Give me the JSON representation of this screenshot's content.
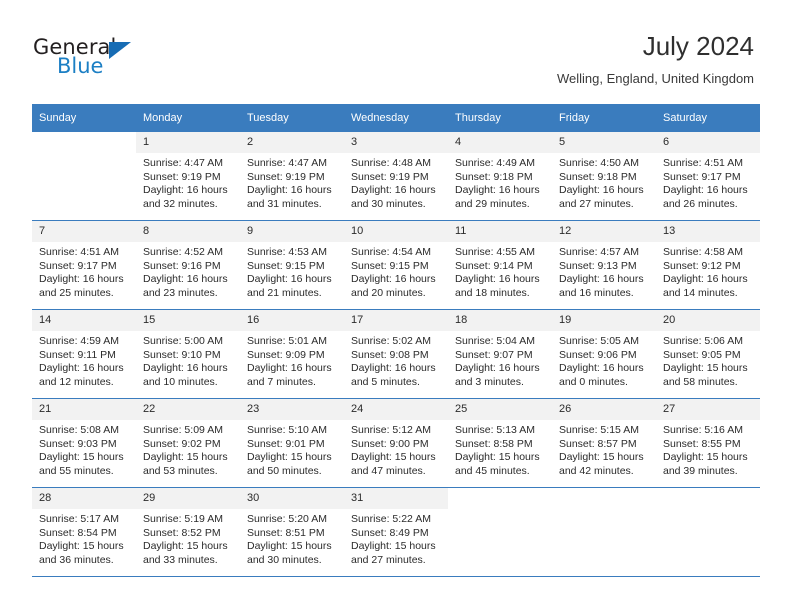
{
  "brand": {
    "word1": "General",
    "word2": "Blue",
    "logo_icon": "triangle-logo-icon",
    "accent_color": "#176cb4"
  },
  "header": {
    "title": "July 2024",
    "subtitle": "Welling, England, United Kingdom"
  },
  "theme": {
    "header_row_bg": "#3a7cbe",
    "daynum_bg": "#f2f2f2",
    "text_color": "#2b2b2b"
  },
  "weekday_headers": [
    "Sunday",
    "Monday",
    "Tuesday",
    "Wednesday",
    "Thursday",
    "Friday",
    "Saturday"
  ],
  "weeks": [
    [
      {
        "day": "",
        "sunrise": "",
        "sunset": "",
        "daylight1": "",
        "daylight2": ""
      },
      {
        "day": "1",
        "sunrise": "Sunrise: 4:47 AM",
        "sunset": "Sunset: 9:19 PM",
        "daylight1": "Daylight: 16 hours",
        "daylight2": "and 32 minutes."
      },
      {
        "day": "2",
        "sunrise": "Sunrise: 4:47 AM",
        "sunset": "Sunset: 9:19 PM",
        "daylight1": "Daylight: 16 hours",
        "daylight2": "and 31 minutes."
      },
      {
        "day": "3",
        "sunrise": "Sunrise: 4:48 AM",
        "sunset": "Sunset: 9:19 PM",
        "daylight1": "Daylight: 16 hours",
        "daylight2": "and 30 minutes."
      },
      {
        "day": "4",
        "sunrise": "Sunrise: 4:49 AM",
        "sunset": "Sunset: 9:18 PM",
        "daylight1": "Daylight: 16 hours",
        "daylight2": "and 29 minutes."
      },
      {
        "day": "5",
        "sunrise": "Sunrise: 4:50 AM",
        "sunset": "Sunset: 9:18 PM",
        "daylight1": "Daylight: 16 hours",
        "daylight2": "and 27 minutes."
      },
      {
        "day": "6",
        "sunrise": "Sunrise: 4:51 AM",
        "sunset": "Sunset: 9:17 PM",
        "daylight1": "Daylight: 16 hours",
        "daylight2": "and 26 minutes."
      }
    ],
    [
      {
        "day": "7",
        "sunrise": "Sunrise: 4:51 AM",
        "sunset": "Sunset: 9:17 PM",
        "daylight1": "Daylight: 16 hours",
        "daylight2": "and 25 minutes."
      },
      {
        "day": "8",
        "sunrise": "Sunrise: 4:52 AM",
        "sunset": "Sunset: 9:16 PM",
        "daylight1": "Daylight: 16 hours",
        "daylight2": "and 23 minutes."
      },
      {
        "day": "9",
        "sunrise": "Sunrise: 4:53 AM",
        "sunset": "Sunset: 9:15 PM",
        "daylight1": "Daylight: 16 hours",
        "daylight2": "and 21 minutes."
      },
      {
        "day": "10",
        "sunrise": "Sunrise: 4:54 AM",
        "sunset": "Sunset: 9:15 PM",
        "daylight1": "Daylight: 16 hours",
        "daylight2": "and 20 minutes."
      },
      {
        "day": "11",
        "sunrise": "Sunrise: 4:55 AM",
        "sunset": "Sunset: 9:14 PM",
        "daylight1": "Daylight: 16 hours",
        "daylight2": "and 18 minutes."
      },
      {
        "day": "12",
        "sunrise": "Sunrise: 4:57 AM",
        "sunset": "Sunset: 9:13 PM",
        "daylight1": "Daylight: 16 hours",
        "daylight2": "and 16 minutes."
      },
      {
        "day": "13",
        "sunrise": "Sunrise: 4:58 AM",
        "sunset": "Sunset: 9:12 PM",
        "daylight1": "Daylight: 16 hours",
        "daylight2": "and 14 minutes."
      }
    ],
    [
      {
        "day": "14",
        "sunrise": "Sunrise: 4:59 AM",
        "sunset": "Sunset: 9:11 PM",
        "daylight1": "Daylight: 16 hours",
        "daylight2": "and 12 minutes."
      },
      {
        "day": "15",
        "sunrise": "Sunrise: 5:00 AM",
        "sunset": "Sunset: 9:10 PM",
        "daylight1": "Daylight: 16 hours",
        "daylight2": "and 10 minutes."
      },
      {
        "day": "16",
        "sunrise": "Sunrise: 5:01 AM",
        "sunset": "Sunset: 9:09 PM",
        "daylight1": "Daylight: 16 hours",
        "daylight2": "and 7 minutes."
      },
      {
        "day": "17",
        "sunrise": "Sunrise: 5:02 AM",
        "sunset": "Sunset: 9:08 PM",
        "daylight1": "Daylight: 16 hours",
        "daylight2": "and 5 minutes."
      },
      {
        "day": "18",
        "sunrise": "Sunrise: 5:04 AM",
        "sunset": "Sunset: 9:07 PM",
        "daylight1": "Daylight: 16 hours",
        "daylight2": "and 3 minutes."
      },
      {
        "day": "19",
        "sunrise": "Sunrise: 5:05 AM",
        "sunset": "Sunset: 9:06 PM",
        "daylight1": "Daylight: 16 hours",
        "daylight2": "and 0 minutes."
      },
      {
        "day": "20",
        "sunrise": "Sunrise: 5:06 AM",
        "sunset": "Sunset: 9:05 PM",
        "daylight1": "Daylight: 15 hours",
        "daylight2": "and 58 minutes."
      }
    ],
    [
      {
        "day": "21",
        "sunrise": "Sunrise: 5:08 AM",
        "sunset": "Sunset: 9:03 PM",
        "daylight1": "Daylight: 15 hours",
        "daylight2": "and 55 minutes."
      },
      {
        "day": "22",
        "sunrise": "Sunrise: 5:09 AM",
        "sunset": "Sunset: 9:02 PM",
        "daylight1": "Daylight: 15 hours",
        "daylight2": "and 53 minutes."
      },
      {
        "day": "23",
        "sunrise": "Sunrise: 5:10 AM",
        "sunset": "Sunset: 9:01 PM",
        "daylight1": "Daylight: 15 hours",
        "daylight2": "and 50 minutes."
      },
      {
        "day": "24",
        "sunrise": "Sunrise: 5:12 AM",
        "sunset": "Sunset: 9:00 PM",
        "daylight1": "Daylight: 15 hours",
        "daylight2": "and 47 minutes."
      },
      {
        "day": "25",
        "sunrise": "Sunrise: 5:13 AM",
        "sunset": "Sunset: 8:58 PM",
        "daylight1": "Daylight: 15 hours",
        "daylight2": "and 45 minutes."
      },
      {
        "day": "26",
        "sunrise": "Sunrise: 5:15 AM",
        "sunset": "Sunset: 8:57 PM",
        "daylight1": "Daylight: 15 hours",
        "daylight2": "and 42 minutes."
      },
      {
        "day": "27",
        "sunrise": "Sunrise: 5:16 AM",
        "sunset": "Sunset: 8:55 PM",
        "daylight1": "Daylight: 15 hours",
        "daylight2": "and 39 minutes."
      }
    ],
    [
      {
        "day": "28",
        "sunrise": "Sunrise: 5:17 AM",
        "sunset": "Sunset: 8:54 PM",
        "daylight1": "Daylight: 15 hours",
        "daylight2": "and 36 minutes."
      },
      {
        "day": "29",
        "sunrise": "Sunrise: 5:19 AM",
        "sunset": "Sunset: 8:52 PM",
        "daylight1": "Daylight: 15 hours",
        "daylight2": "and 33 minutes."
      },
      {
        "day": "30",
        "sunrise": "Sunrise: 5:20 AM",
        "sunset": "Sunset: 8:51 PM",
        "daylight1": "Daylight: 15 hours",
        "daylight2": "and 30 minutes."
      },
      {
        "day": "31",
        "sunrise": "Sunrise: 5:22 AM",
        "sunset": "Sunset: 8:49 PM",
        "daylight1": "Daylight: 15 hours",
        "daylight2": "and 27 minutes."
      },
      {
        "day": "",
        "sunrise": "",
        "sunset": "",
        "daylight1": "",
        "daylight2": ""
      },
      {
        "day": "",
        "sunrise": "",
        "sunset": "",
        "daylight1": "",
        "daylight2": ""
      },
      {
        "day": "",
        "sunrise": "",
        "sunset": "",
        "daylight1": "",
        "daylight2": ""
      }
    ]
  ]
}
